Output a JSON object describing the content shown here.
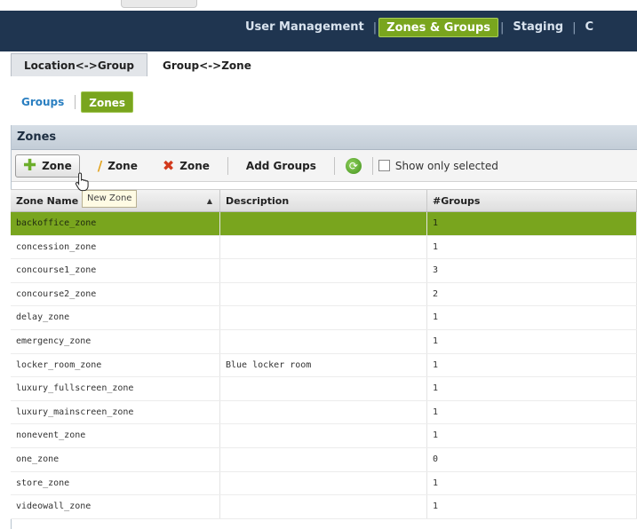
{
  "topnav": {
    "items": [
      {
        "label": "User Management",
        "active": false
      },
      {
        "label": "Zones & Groups",
        "active": true
      },
      {
        "label": "Staging",
        "active": false
      },
      {
        "label": "C",
        "active": false
      }
    ]
  },
  "subtabs": [
    {
      "label": "Location<->Group",
      "active": false
    },
    {
      "label": "Group<->Zone",
      "active": true
    }
  ],
  "toggle": {
    "groups_label": "Groups",
    "zones_label": "Zones"
  },
  "panel": {
    "title": "Zones"
  },
  "toolbar": {
    "new_zone_label": "Zone",
    "edit_zone_label": "Zone",
    "delete_zone_label": "Zone",
    "add_groups_label": "Add Groups",
    "show_only_selected_label": "Show only selected",
    "show_only_selected_checked": false
  },
  "tooltip": {
    "text": "New Zone"
  },
  "table": {
    "columns": [
      "Zone Name",
      "Description",
      "#Groups"
    ],
    "sort": {
      "column": "Zone Name",
      "direction": "ascending"
    },
    "selected_row": 0,
    "rows": [
      {
        "name": "backoffice_zone",
        "description": "",
        "groups": "1"
      },
      {
        "name": "concession_zone",
        "description": "",
        "groups": "1"
      },
      {
        "name": "concourse1_zone",
        "description": "",
        "groups": "3"
      },
      {
        "name": "concourse2_zone",
        "description": "",
        "groups": "2"
      },
      {
        "name": "delay_zone",
        "description": "",
        "groups": "1"
      },
      {
        "name": "emergency_zone",
        "description": "",
        "groups": "1"
      },
      {
        "name": "locker_room_zone",
        "description": "Blue locker room",
        "groups": "1"
      },
      {
        "name": "luxury_fullscreen_zone",
        "description": "",
        "groups": "1"
      },
      {
        "name": "luxury_mainscreen_zone",
        "description": "",
        "groups": "1"
      },
      {
        "name": "nonevent_zone",
        "description": "",
        "groups": "1"
      },
      {
        "name": "one_zone",
        "description": "",
        "groups": "0"
      },
      {
        "name": "store_zone",
        "description": "",
        "groups": "1"
      },
      {
        "name": "videowall_zone",
        "description": "",
        "groups": "1"
      }
    ]
  },
  "colors": {
    "header_bg": "#1f3550",
    "accent_green": "#79a51e",
    "link_blue": "#2a7fc1"
  },
  "icons": {
    "new": "plus-icon",
    "edit": "pencil-icon",
    "delete": "x-icon",
    "refresh": "refresh-icon",
    "cursor": "hand-cursor-icon"
  }
}
